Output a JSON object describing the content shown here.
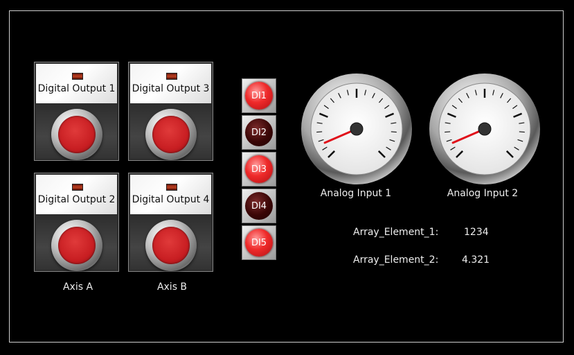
{
  "digital_outputs": [
    {
      "label": "Digital Output 1"
    },
    {
      "label": "Digital Output 3"
    },
    {
      "label": "Digital Output 2"
    },
    {
      "label": "Digital Output 4"
    }
  ],
  "axes": [
    "Axis A",
    "Axis B"
  ],
  "digital_inputs": [
    {
      "label": "DI1",
      "state": "on"
    },
    {
      "label": "DI2",
      "state": "off"
    },
    {
      "label": "DI3",
      "state": "on"
    },
    {
      "label": "DI4",
      "state": "off"
    },
    {
      "label": "DI5",
      "state": "on"
    }
  ],
  "analog_inputs": [
    {
      "label": "Analog Input 1",
      "needle_fraction": 0.08
    },
    {
      "label": "Analog Input 2",
      "needle_fraction": 0.08
    }
  ],
  "array_elements": [
    {
      "key": "Array_Element_1:",
      "value": "1234"
    },
    {
      "key": "Array_Element_2:",
      "value": "4.321"
    }
  ],
  "colors": {
    "background": "#000000",
    "button_red": "#c81e22",
    "led_on": "#ef2a2a",
    "led_off": "#3a0606",
    "needle": "#e0101a"
  }
}
